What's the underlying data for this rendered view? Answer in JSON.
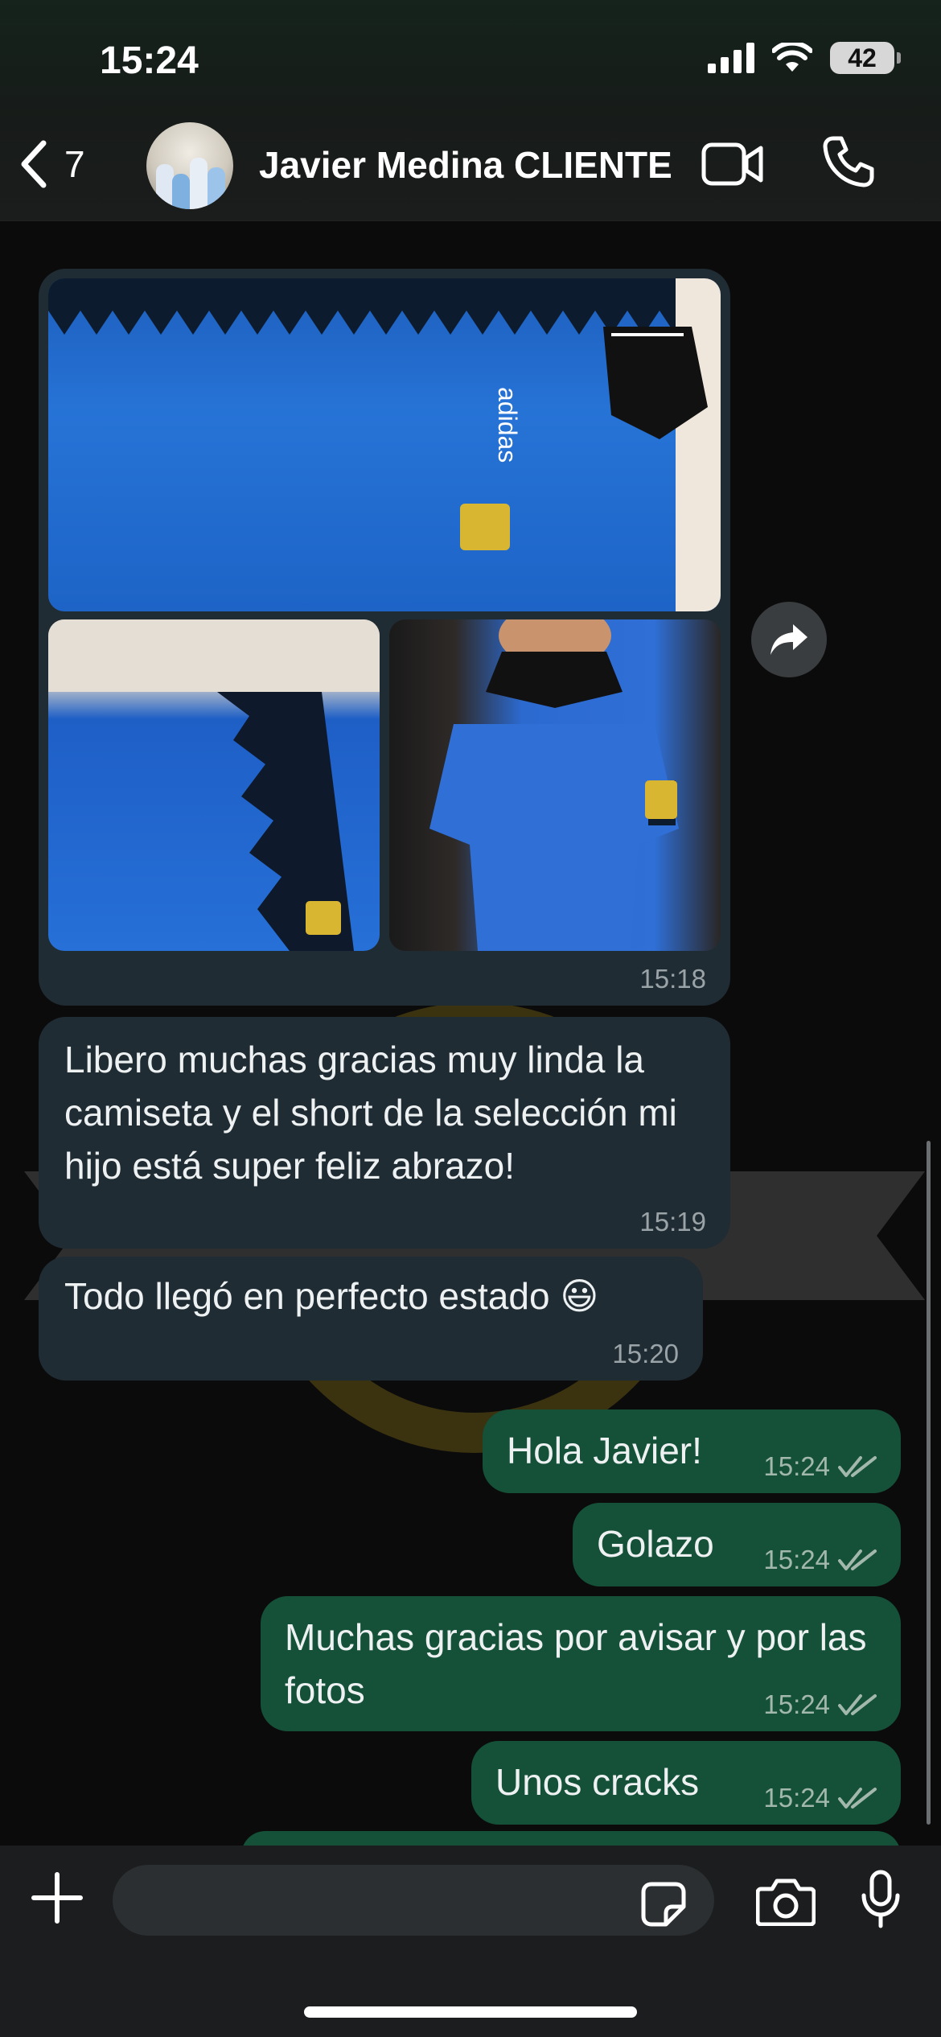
{
  "status_bar": {
    "time": "15:24",
    "battery": "42"
  },
  "header": {
    "back_count": "7",
    "contact_name": "Javier Medina CLIENTE"
  },
  "media_message": {
    "time": "15:18"
  },
  "messages_in": [
    {
      "text": "Libero muchas gracias muy linda la camiseta y el short de la selección mi hijo está super feliz abrazo!",
      "time": "15:19"
    },
    {
      "text": "Todo llegó en perfecto estado 😃",
      "time": "15:20"
    }
  ],
  "messages_out": [
    {
      "text": "Hola Javier!",
      "time": "15:24"
    },
    {
      "text": "Golazo",
      "time": "15:24"
    },
    {
      "text": "Muchas gracias por avisar y por las fotos",
      "time": "15:24"
    },
    {
      "text": "Unos cracks",
      "time": "15:24"
    }
  ],
  "colors": {
    "incoming_bubble": "#202c33",
    "outgoing_bubble": "#155038",
    "background": "#0b0b0b"
  },
  "icons": [
    "back-chevron-icon",
    "video-call-icon",
    "phone-icon",
    "forward-icon",
    "plus-icon",
    "sticker-icon",
    "camera-icon",
    "mic-icon",
    "double-check-icon"
  ]
}
